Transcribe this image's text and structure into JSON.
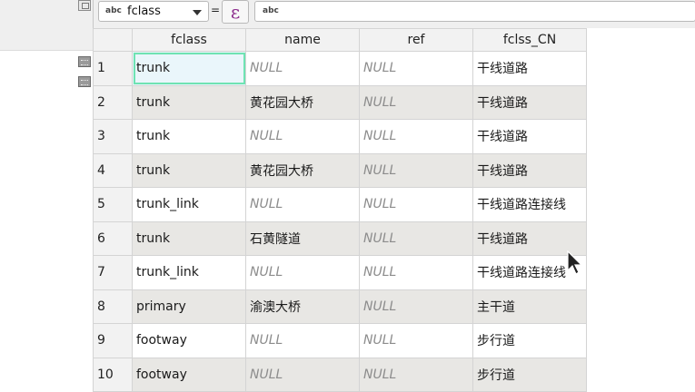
{
  "toolbar": {
    "field_type": "abc",
    "field_name": "fclass",
    "equals": "=",
    "expression_symbol": "ε",
    "input_type": "abc"
  },
  "columns": [
    "fclass",
    "name",
    "ref",
    "fclss_CN"
  ],
  "rows": [
    {
      "num": "1",
      "fclass": "trunk",
      "name": "NULL",
      "ref": "NULL",
      "fclss_CN": "干线道路"
    },
    {
      "num": "2",
      "fclass": "trunk",
      "name": "黄花园大桥",
      "ref": "NULL",
      "fclss_CN": "干线道路"
    },
    {
      "num": "3",
      "fclass": "trunk",
      "name": "NULL",
      "ref": "NULL",
      "fclss_CN": "干线道路"
    },
    {
      "num": "4",
      "fclass": "trunk",
      "name": "黄花园大桥",
      "ref": "NULL",
      "fclss_CN": "干线道路"
    },
    {
      "num": "5",
      "fclass": "trunk_link",
      "name": "NULL",
      "ref": "NULL",
      "fclss_CN": "干线道路连接线"
    },
    {
      "num": "6",
      "fclass": "trunk",
      "name": "石黄隧道",
      "ref": "NULL",
      "fclss_CN": "干线道路"
    },
    {
      "num": "7",
      "fclass": "trunk_link",
      "name": "NULL",
      "ref": "NULL",
      "fclss_CN": "干线道路连接线"
    },
    {
      "num": "8",
      "fclass": "primary",
      "name": "渝澳大桥",
      "ref": "NULL",
      "fclss_CN": "主干道"
    },
    {
      "num": "9",
      "fclass": "footway",
      "name": "NULL",
      "ref": "NULL",
      "fclss_CN": "步行道"
    },
    {
      "num": "10",
      "fclass": "footway",
      "name": "NULL",
      "ref": "NULL",
      "fclss_CN": "步行道"
    }
  ],
  "colors": {
    "alt_row": "#e8e7e4",
    "selected_border": "#6fe3b3",
    "expression_icon": "#8b2a8b"
  }
}
